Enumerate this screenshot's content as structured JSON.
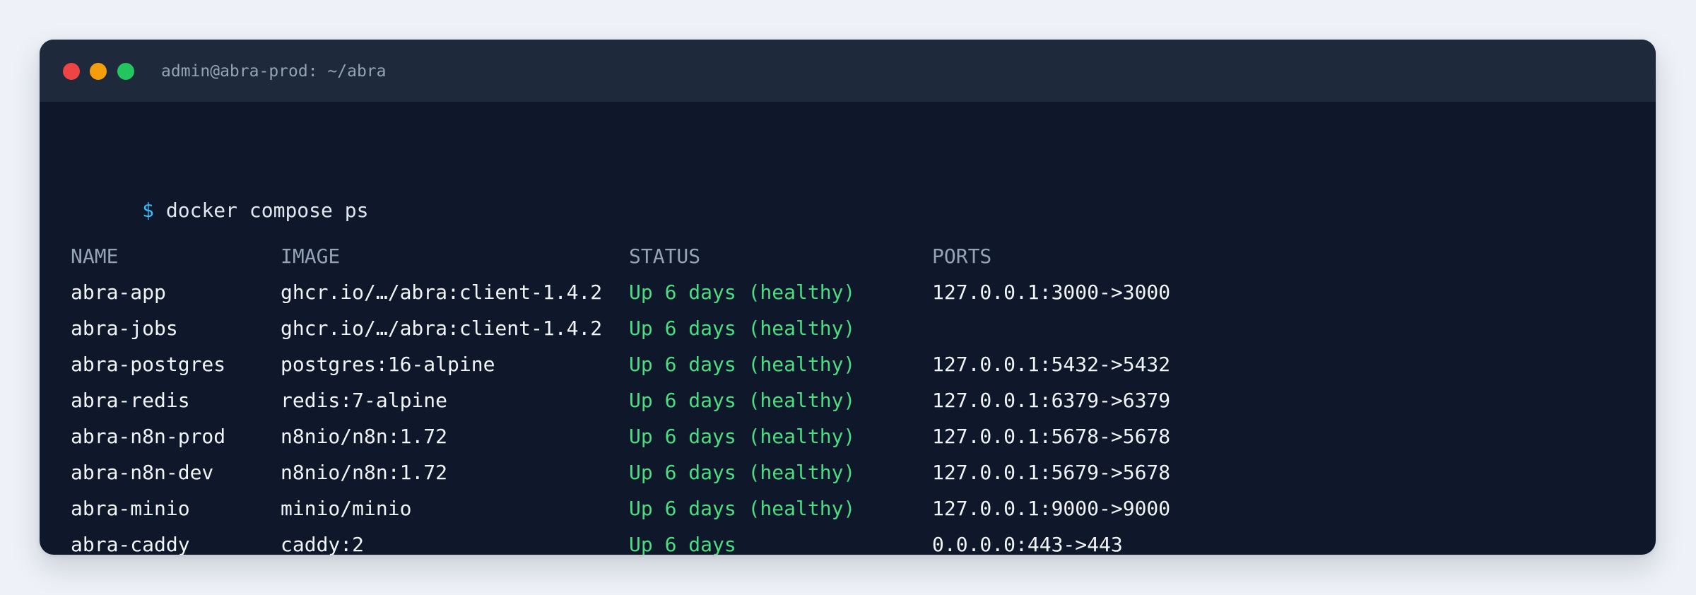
{
  "window": {
    "title": "admin@abra-prod: ~/abra"
  },
  "terminal": {
    "prompt_symbol": "$",
    "command": "docker compose ps",
    "headers": {
      "name": "NAME",
      "image": "IMAGE",
      "status": "STATUS",
      "ports": "PORTS"
    },
    "rows": [
      {
        "name": "abra-app",
        "image": "ghcr.io/…/abra:client-1.4.2",
        "status": "Up 6 days (healthy)",
        "ports": "127.0.0.1:3000->3000"
      },
      {
        "name": "abra-jobs",
        "image": "ghcr.io/…/abra:client-1.4.2",
        "status": "Up 6 days (healthy)",
        "ports": ""
      },
      {
        "name": "abra-postgres",
        "image": "postgres:16-alpine",
        "status": "Up 6 days (healthy)",
        "ports": "127.0.0.1:5432->5432"
      },
      {
        "name": "abra-redis",
        "image": "redis:7-alpine",
        "status": "Up 6 days (healthy)",
        "ports": "127.0.0.1:6379->6379"
      },
      {
        "name": "abra-n8n-prod",
        "image": "n8nio/n8n:1.72",
        "status": "Up 6 days (healthy)",
        "ports": "127.0.0.1:5678->5678"
      },
      {
        "name": "abra-n8n-dev",
        "image": "n8nio/n8n:1.72",
        "status": "Up 6 days (healthy)",
        "ports": "127.0.0.1:5679->5678"
      },
      {
        "name": "abra-minio",
        "image": "minio/minio",
        "status": "Up 6 days (healthy)",
        "ports": "127.0.0.1:9000->9000"
      },
      {
        "name": "abra-caddy",
        "image": "caddy:2",
        "status": "Up 6 days",
        "ports": "0.0.0.0:443->443"
      }
    ]
  },
  "colors": {
    "page_background": "#eef1f7",
    "terminal_background": "#0f172a",
    "titlebar_background": "#1e293b",
    "prompt": "#38bdf8",
    "healthy_status": "#4ade80",
    "header_text": "#94a3b8",
    "close_dot": "#ef4444",
    "minimize_dot": "#f59e0b",
    "maximize_dot": "#22c55e"
  }
}
